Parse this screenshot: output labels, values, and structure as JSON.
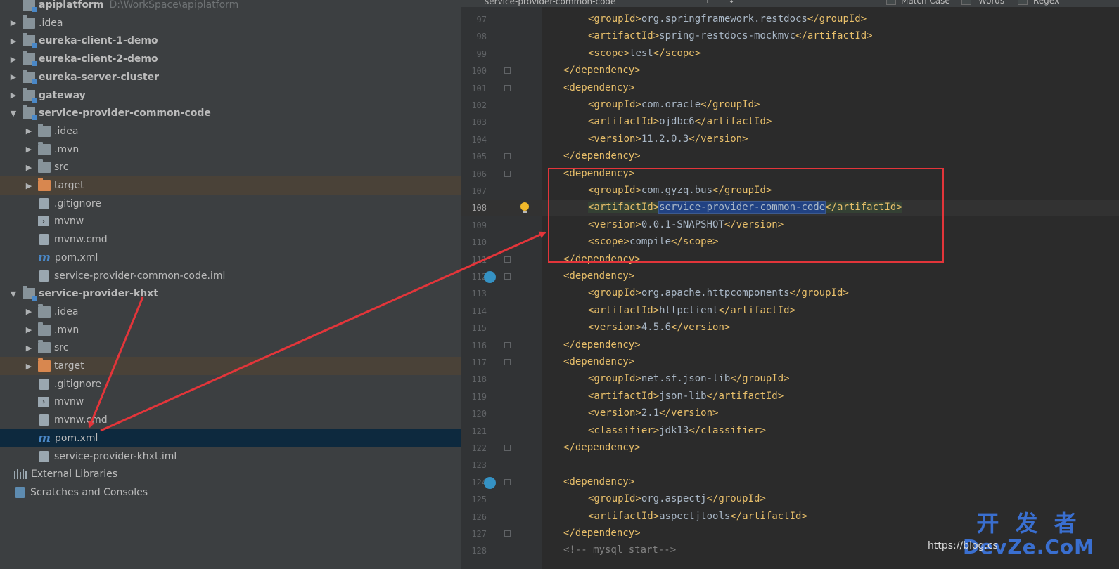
{
  "project_tree": {
    "rows": [
      {
        "label": "apiplatform",
        "suffix": "D:\\WorkSpace\\apiplatform",
        "indent": 0,
        "arrow": "",
        "icon": "module-folder",
        "bold": true,
        "state": ""
      },
      {
        "label": ".idea",
        "indent": 0,
        "arrow": "▶",
        "icon": "folder",
        "bold": false,
        "state": ""
      },
      {
        "label": "eureka-client-1-demo",
        "indent": 0,
        "arrow": "▶",
        "icon": "module-folder",
        "bold": true,
        "state": ""
      },
      {
        "label": "eureka-client-2-demo",
        "indent": 0,
        "arrow": "▶",
        "icon": "module-folder",
        "bold": true,
        "state": ""
      },
      {
        "label": "eureka-server-cluster",
        "indent": 0,
        "arrow": "▶",
        "icon": "module-folder",
        "bold": true,
        "state": ""
      },
      {
        "label": "gateway",
        "indent": 0,
        "arrow": "▶",
        "icon": "module-folder",
        "bold": true,
        "state": ""
      },
      {
        "label": "service-provider-common-code",
        "indent": 0,
        "arrow": "▼",
        "icon": "module-folder",
        "bold": true,
        "state": ""
      },
      {
        "label": ".idea",
        "indent": 1,
        "arrow": "▶",
        "icon": "folder",
        "bold": false,
        "state": ""
      },
      {
        "label": ".mvn",
        "indent": 1,
        "arrow": "▶",
        "icon": "folder",
        "bold": false,
        "state": ""
      },
      {
        "label": "src",
        "indent": 1,
        "arrow": "▶",
        "icon": "folder",
        "bold": false,
        "state": ""
      },
      {
        "label": "target",
        "indent": 1,
        "arrow": "▶",
        "icon": "folder-orange",
        "bold": false,
        "state": "target"
      },
      {
        "label": ".gitignore",
        "indent": 1,
        "arrow": "",
        "icon": "file",
        "bold": false,
        "state": ""
      },
      {
        "label": "mvnw",
        "indent": 1,
        "arrow": "",
        "icon": "terminal",
        "bold": false,
        "state": ""
      },
      {
        "label": "mvnw.cmd",
        "indent": 1,
        "arrow": "",
        "icon": "file",
        "bold": false,
        "state": ""
      },
      {
        "label": "pom.xml",
        "indent": 1,
        "arrow": "",
        "icon": "maven",
        "bold": false,
        "state": ""
      },
      {
        "label": "service-provider-common-code.iml",
        "indent": 1,
        "arrow": "",
        "icon": "file",
        "bold": false,
        "state": ""
      },
      {
        "label": "service-provider-khxt",
        "indent": 0,
        "arrow": "▼",
        "icon": "module-folder",
        "bold": true,
        "state": ""
      },
      {
        "label": ".idea",
        "indent": 1,
        "arrow": "▶",
        "icon": "folder",
        "bold": false,
        "state": ""
      },
      {
        "label": ".mvn",
        "indent": 1,
        "arrow": "▶",
        "icon": "folder",
        "bold": false,
        "state": ""
      },
      {
        "label": "src",
        "indent": 1,
        "arrow": "▶",
        "icon": "folder",
        "bold": false,
        "state": ""
      },
      {
        "label": "target",
        "indent": 1,
        "arrow": "▶",
        "icon": "folder-orange",
        "bold": false,
        "state": "target"
      },
      {
        "label": ".gitignore",
        "indent": 1,
        "arrow": "",
        "icon": "file",
        "bold": false,
        "state": ""
      },
      {
        "label": "mvnw",
        "indent": 1,
        "arrow": "",
        "icon": "terminal",
        "bold": false,
        "state": ""
      },
      {
        "label": "mvnw.cmd",
        "indent": 1,
        "arrow": "",
        "icon": "file",
        "bold": false,
        "state": ""
      },
      {
        "label": "pom.xml",
        "indent": 1,
        "arrow": "",
        "icon": "maven",
        "bold": false,
        "state": "selected"
      },
      {
        "label": "service-provider-khxt.iml",
        "indent": 1,
        "arrow": "",
        "icon": "file",
        "bold": false,
        "state": ""
      },
      {
        "label": "External Libraries",
        "indent": -1,
        "arrow": "",
        "icon": "library",
        "bold": false,
        "state": ""
      },
      {
        "label": "Scratches and Consoles",
        "indent": -1,
        "arrow": "",
        "icon": "scratch",
        "bold": false,
        "state": ""
      }
    ]
  },
  "find_bar": {
    "search_value": "service-provider-common-code",
    "match_case_label": "Match Case",
    "words_label": "Words",
    "regex_label": "Regex"
  },
  "editor": {
    "current_line": "108",
    "lines": [
      {
        "n": "97",
        "indent": 2,
        "text": "<groupId>org.springframework.restdocs</groupId>"
      },
      {
        "n": "98",
        "indent": 2,
        "text": "<artifactId>spring-restdocs-mockmvc</artifactId>"
      },
      {
        "n": "99",
        "indent": 2,
        "text": "<scope>test</scope>"
      },
      {
        "n": "100",
        "indent": 1,
        "text": "</dependency>"
      },
      {
        "n": "101",
        "indent": 1,
        "text": "<dependency>"
      },
      {
        "n": "102",
        "indent": 2,
        "text": "<groupId>com.oracle</groupId>"
      },
      {
        "n": "103",
        "indent": 2,
        "text": "<artifactId>ojdbc6</artifactId>"
      },
      {
        "n": "104",
        "indent": 2,
        "text": "<version>11.2.0.3</version>"
      },
      {
        "n": "105",
        "indent": 1,
        "text": "</dependency>"
      },
      {
        "n": "106",
        "indent": 1,
        "text": "<dependency>"
      },
      {
        "n": "107",
        "indent": 2,
        "text": "<groupId>com.gyzq.bus</groupId>"
      },
      {
        "n": "108",
        "indent": 2,
        "text": "<artifactId>service-provider-common-code</artifactId>"
      },
      {
        "n": "109",
        "indent": 2,
        "text": "<version>0.0.1-SNAPSHOT</version>"
      },
      {
        "n": "110",
        "indent": 2,
        "text": "<scope>compile</scope>"
      },
      {
        "n": "111",
        "indent": 1,
        "text": "</dependency>"
      },
      {
        "n": "112",
        "indent": 1,
        "text": "<dependency>"
      },
      {
        "n": "113",
        "indent": 2,
        "text": "<groupId>org.apache.httpcomponents</groupId>"
      },
      {
        "n": "114",
        "indent": 2,
        "text": "<artifactId>httpclient</artifactId>"
      },
      {
        "n": "115",
        "indent": 2,
        "text": "<version>4.5.6</version>"
      },
      {
        "n": "116",
        "indent": 1,
        "text": "</dependency>"
      },
      {
        "n": "117",
        "indent": 1,
        "text": "<dependency>"
      },
      {
        "n": "118",
        "indent": 2,
        "text": "<groupId>net.sf.json-lib</groupId>"
      },
      {
        "n": "119",
        "indent": 2,
        "text": "<artifactId>json-lib</artifactId>"
      },
      {
        "n": "120",
        "indent": 2,
        "text": "<version>2.1</version>"
      },
      {
        "n": "121",
        "indent": 2,
        "text": "<classifier>jdk13</classifier>"
      },
      {
        "n": "122",
        "indent": 1,
        "text": "</dependency>"
      },
      {
        "n": "123",
        "indent": 0,
        "text": ""
      },
      {
        "n": "124",
        "indent": 1,
        "text": "<dependency>"
      },
      {
        "n": "125",
        "indent": 2,
        "text": "<groupId>org.aspectj</groupId>"
      },
      {
        "n": "126",
        "indent": 2,
        "text": "<artifactId>aspectjtools</artifactId>"
      },
      {
        "n": "127",
        "indent": 1,
        "text": "</dependency>"
      },
      {
        "n": "128",
        "indent": 1,
        "text": "<!-- mysql start-->"
      }
    ]
  },
  "watermark": {
    "line1": "开 发 者",
    "line2": "DevZe.CoM",
    "url": "https://blog.cs"
  },
  "colors": {
    "tree_bg": "#3c3f41",
    "editor_bg": "#2b2b2b",
    "tag": "#e8bf6a",
    "annotation_red": "#e3353a",
    "selection": "#0d293e"
  }
}
